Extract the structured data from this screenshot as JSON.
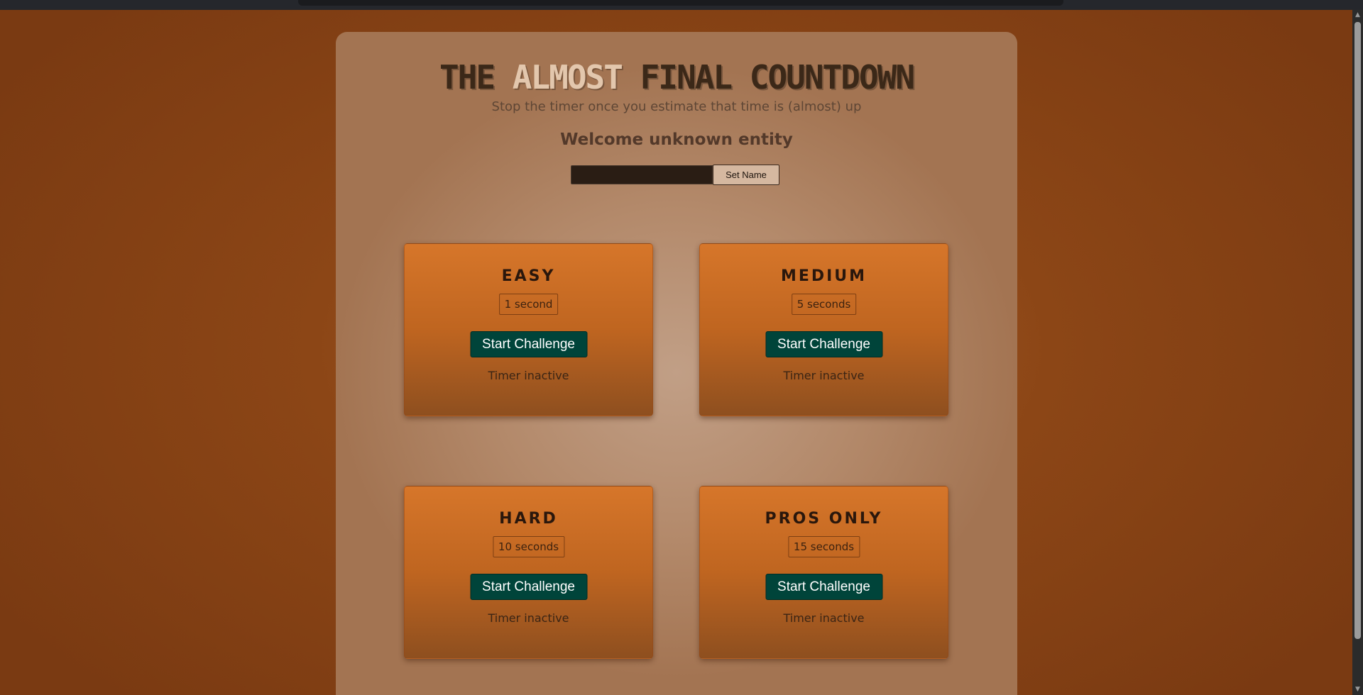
{
  "page": {
    "title_parts": [
      "THE ",
      "ALMOST",
      " FINAL COUNTDOWN"
    ],
    "subtitle": "Stop the timer once you estimate that time is (almost) up",
    "welcome": "Welcome unknown entity"
  },
  "name_form": {
    "input_value": "",
    "input_placeholder": "",
    "set_button_label": "Set Name"
  },
  "challenges": [
    {
      "title": "EASY",
      "duration": "1 second",
      "button_label": "Start Challenge",
      "status": "Timer inactive"
    },
    {
      "title": "MEDIUM",
      "duration": "5 seconds",
      "button_label": "Start Challenge",
      "status": "Timer inactive"
    },
    {
      "title": "HARD",
      "duration": "10 seconds",
      "button_label": "Start Challenge",
      "status": "Timer inactive"
    },
    {
      "title": "PROS ONLY",
      "duration": "15 seconds",
      "button_label": "Start Challenge",
      "status": "Timer inactive"
    }
  ],
  "scrollbar": {
    "up_icon": "triangle-up",
    "down_icon": "triangle-down"
  },
  "colors": {
    "background": "#8c4616",
    "panel": "#b3896a",
    "card_top": "#d6762a",
    "card_bottom": "#8e4f1f",
    "button": "#00443a",
    "title_accent": "#e3c7ad"
  }
}
